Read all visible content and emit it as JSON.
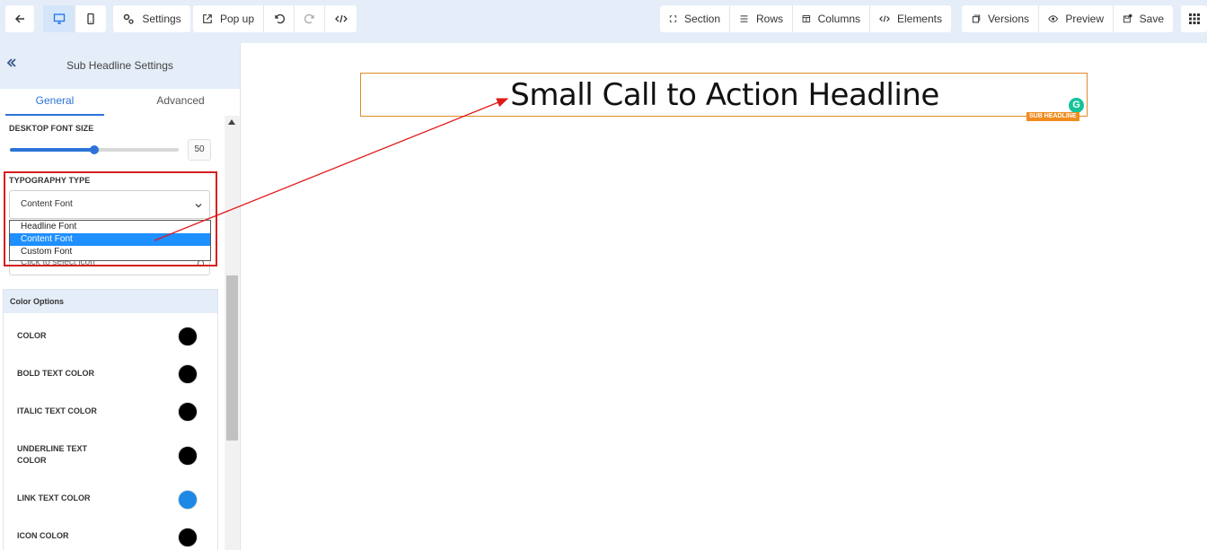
{
  "toolbar": {
    "back_icon": "arrow-left-icon",
    "settings_label": "Settings",
    "popup_label": "Pop up",
    "section_label": "Section",
    "rows_label": "Rows",
    "columns_label": "Columns",
    "elements_label": "Elements",
    "versions_label": "Versions",
    "preview_label": "Preview",
    "save_label": "Save"
  },
  "panel": {
    "title": "Sub Headline Settings",
    "tabs": [
      {
        "label": "General",
        "active": true
      },
      {
        "label": "Advanced",
        "active": false
      }
    ],
    "font_size": {
      "label": "DESKTOP FONT SIZE",
      "value": "50",
      "slider_fraction": 0.5
    },
    "typography": {
      "label": "TYPOGRAPHY TYPE",
      "selected": "Content Font",
      "options": [
        "Headline Font",
        "Content Font",
        "Custom Font"
      ]
    },
    "icon_select": {
      "placeholder": "Click to select icon"
    },
    "color_options": {
      "title": "Color Options",
      "rows": [
        {
          "label": "COLOR",
          "color": "#000000"
        },
        {
          "label": "BOLD TEXT COLOR",
          "color": "#000000"
        },
        {
          "label": "ITALIC TEXT COLOR",
          "color": "#000000"
        },
        {
          "label": "UNDERLINE TEXT COLOR",
          "color": "#000000"
        },
        {
          "label": "LINK TEXT COLOR",
          "color": "#1e88e5"
        },
        {
          "label": "ICON COLOR",
          "color": "#000000"
        }
      ]
    }
  },
  "canvas": {
    "headline": "Small Call to Action Headline",
    "element_badge": "SUB HEADLINE",
    "grammarly_badge": "G"
  },
  "colors": {
    "accent": "#2b73d8",
    "highlight": "#d61f1f",
    "element_outline": "#e08a25"
  }
}
